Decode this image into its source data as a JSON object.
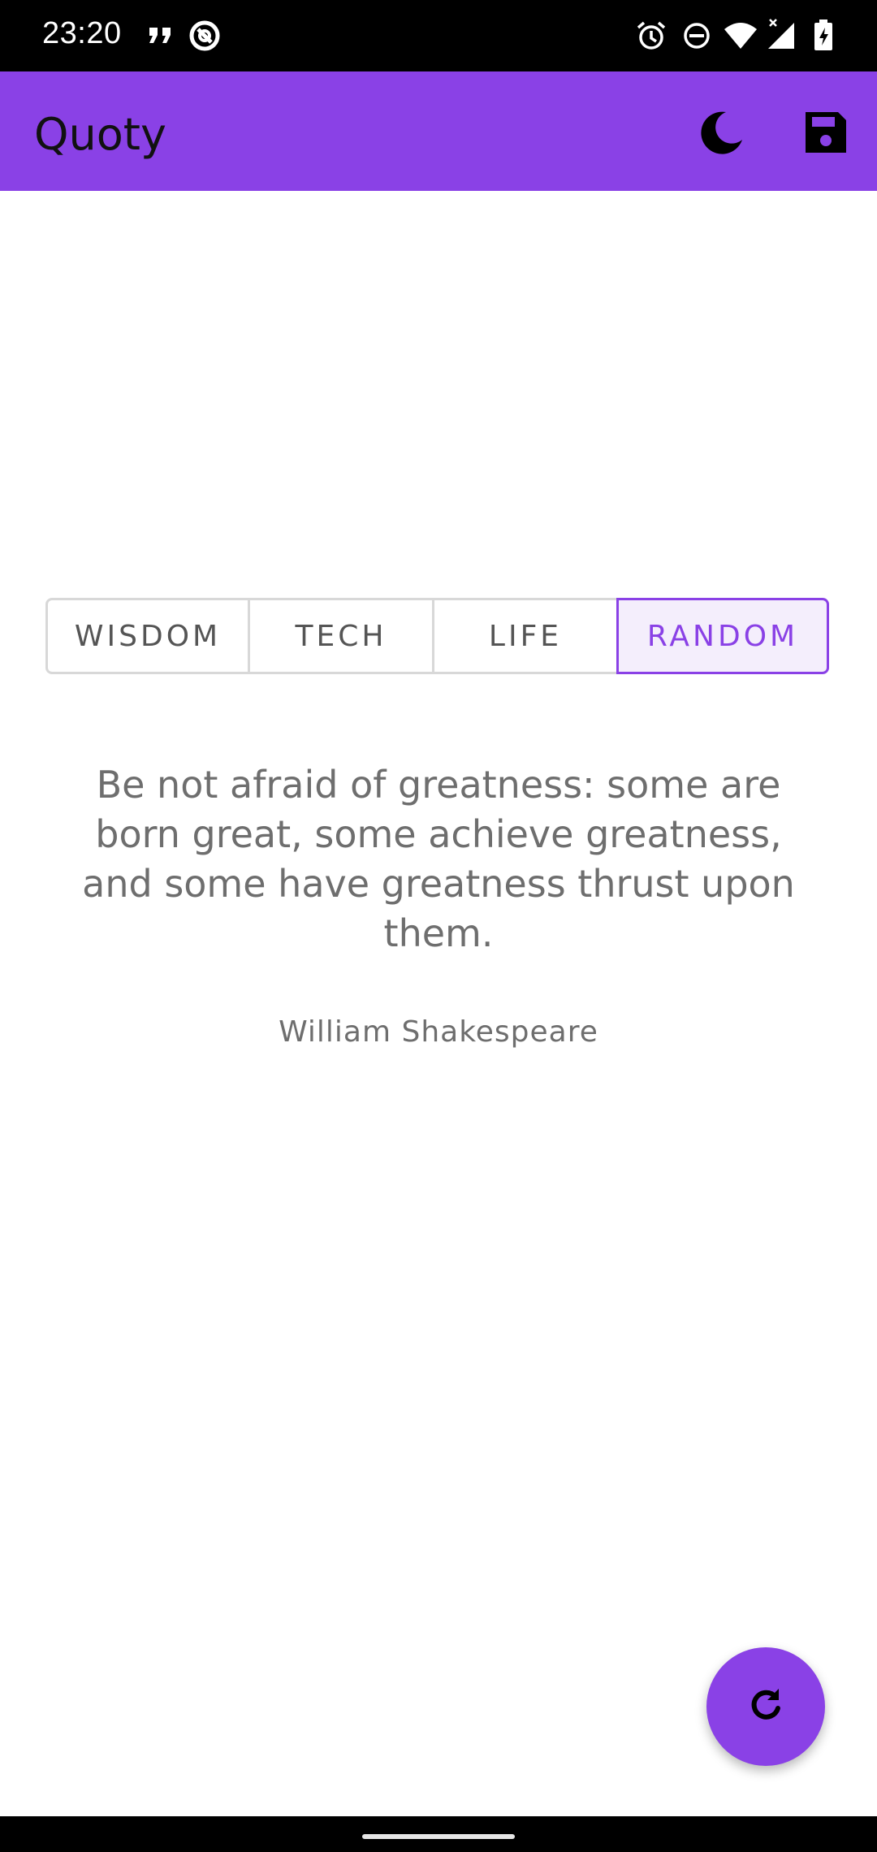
{
  "status_bar": {
    "time": "23:20",
    "icons": [
      "quote-notification-icon",
      "at-sign-icon",
      "alarm-icon",
      "do-not-disturb-icon",
      "wifi-icon",
      "cell-signal-icon",
      "battery-charging-icon"
    ]
  },
  "app_bar": {
    "title": "Quoty",
    "actions": [
      "dark-mode-icon",
      "save-icon"
    ],
    "color": "#8a41e6"
  },
  "categories": {
    "items": [
      "WISDOM",
      "TECH",
      "LIFE",
      "RANDOM"
    ],
    "selected": "RANDOM"
  },
  "quote": {
    "text": "Be not afraid of greatness: some are born great, some achieve greatness, and some have greatness thrust upon them.",
    "author": "William Shakespeare"
  },
  "fab": {
    "icon": "refresh-icon"
  },
  "colors": {
    "accent": "#8a41e6",
    "text_muted": "#6e6e6e"
  }
}
